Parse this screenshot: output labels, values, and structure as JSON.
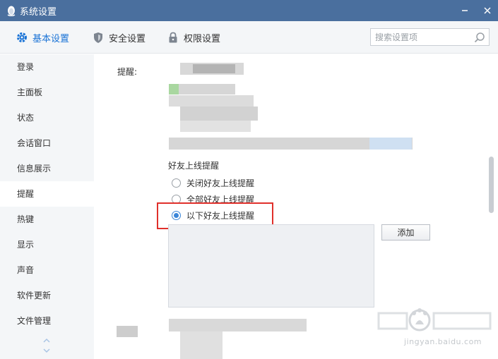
{
  "window": {
    "title": "系统设置",
    "icon": "penguin-icon",
    "titlebar_color": "#4a6f9e"
  },
  "tabs": [
    {
      "label": "基本设置",
      "icon": "gear-icon",
      "active": true
    },
    {
      "label": "安全设置",
      "icon": "shield-icon",
      "active": false
    },
    {
      "label": "权限设置",
      "icon": "lock-icon",
      "active": false
    }
  ],
  "search": {
    "placeholder": "搜索设置项",
    "value": ""
  },
  "sidebar": {
    "items": [
      {
        "label": "登录"
      },
      {
        "label": "主面板"
      },
      {
        "label": "状态"
      },
      {
        "label": "会话窗口"
      },
      {
        "label": "信息展示"
      },
      {
        "label": "提醒",
        "active": true
      },
      {
        "label": "热键"
      },
      {
        "label": "显示"
      },
      {
        "label": "声音"
      },
      {
        "label": "软件更新"
      },
      {
        "label": "文件管理"
      }
    ]
  },
  "content": {
    "reminder_label": "提醒:",
    "friend_online": {
      "title": "好友上线提醒",
      "options": [
        {
          "label": "关闭好友上线提醒",
          "checked": false
        },
        {
          "label": "全部好友上线提醒",
          "checked": false
        },
        {
          "label": "以下好友上线提醒",
          "checked": true
        }
      ],
      "add_button": "添加"
    }
  },
  "watermark": {
    "text": "jingyan.baidu.com"
  },
  "colors": {
    "accent": "#1a73d6",
    "highlight": "#e0302b",
    "radio": "#3b86d8"
  }
}
